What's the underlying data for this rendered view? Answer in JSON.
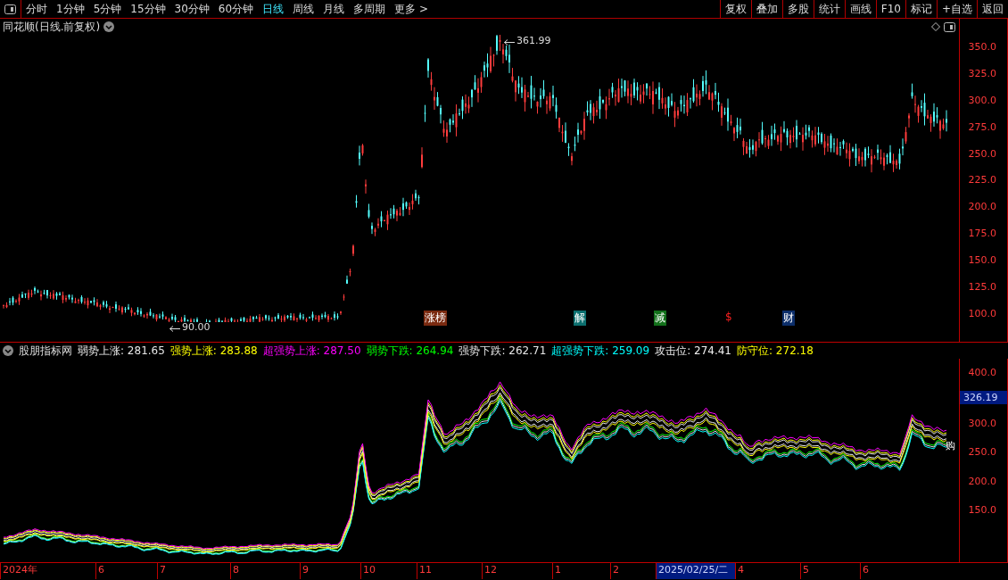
{
  "toolbar": {
    "periods": [
      {
        "label": "分时",
        "selected": false
      },
      {
        "label": "1分钟",
        "selected": false
      },
      {
        "label": "5分钟",
        "selected": false
      },
      {
        "label": "15分钟",
        "selected": false
      },
      {
        "label": "30分钟",
        "selected": false
      },
      {
        "label": "60分钟",
        "selected": false
      },
      {
        "label": "日线",
        "selected": true
      },
      {
        "label": "周线",
        "selected": false
      },
      {
        "label": "月线",
        "selected": false
      },
      {
        "label": "多周期",
        "selected": false
      },
      {
        "label": "更多 >",
        "selected": false
      }
    ],
    "actions": [
      "复权",
      "叠加",
      "多股",
      "统计",
      "画线",
      "F10",
      "标记",
      "+自选",
      "返回"
    ]
  },
  "main_chart": {
    "title": "同花顺(日线.前复权)",
    "high_label": "361.99",
    "low_label": "90.00",
    "axis_ticks": [
      "350.0",
      "325.0",
      "300.0",
      "275.0",
      "250.0",
      "225.0",
      "200.0",
      "175.0",
      "150.0",
      "125.0",
      "100.0"
    ],
    "events": [
      {
        "label": "涨榜",
        "color": "#7a2a10"
      },
      {
        "label": "解",
        "color": "#0c6f6f"
      },
      {
        "label": "减",
        "color": "#12701a"
      },
      {
        "label": "$",
        "color": "#000000"
      },
      {
        "label": "财",
        "color": "#0c2e6a"
      }
    ]
  },
  "indicator": {
    "name": "股朋指标网",
    "legend": [
      {
        "label": "弱势上涨: 281.65",
        "color": "#e6e6e6"
      },
      {
        "label": "强势上涨: 283.88",
        "color": "#ffff00"
      },
      {
        "label": "超强势上涨: 287.50",
        "color": "#ff00ff"
      },
      {
        "label": "弱势下跌: 264.94",
        "color": "#00ff00"
      },
      {
        "label": "强势下跌: 262.71",
        "color": "#e6e6e6"
      },
      {
        "label": "超强势下跌: 259.09",
        "color": "#00ffff"
      },
      {
        "label": "攻击位: 274.41",
        "color": "#f0f0f0"
      },
      {
        "label": "防守位: 272.18",
        "color": "#ffff00"
      }
    ],
    "axis_ticks": [
      "400.0",
      "300.0",
      "250.0",
      "200.0",
      "150.0"
    ],
    "current_value": "326.19",
    "end_tag": "购"
  },
  "date_axis": [
    {
      "label": "2024年",
      "selected": false
    },
    {
      "label": "6",
      "selected": false
    },
    {
      "label": "7",
      "selected": false
    },
    {
      "label": "8",
      "selected": false
    },
    {
      "label": "9",
      "selected": false
    },
    {
      "label": "10",
      "selected": false
    },
    {
      "label": "11",
      "selected": false
    },
    {
      "label": "12",
      "selected": false
    },
    {
      "label": "1",
      "selected": false
    },
    {
      "label": "2",
      "selected": false
    },
    {
      "label": "2025/02/25/二",
      "selected": true
    },
    {
      "label": "4",
      "selected": false
    },
    {
      "label": "5",
      "selected": false
    },
    {
      "label": "6",
      "selected": false
    }
  ]
}
